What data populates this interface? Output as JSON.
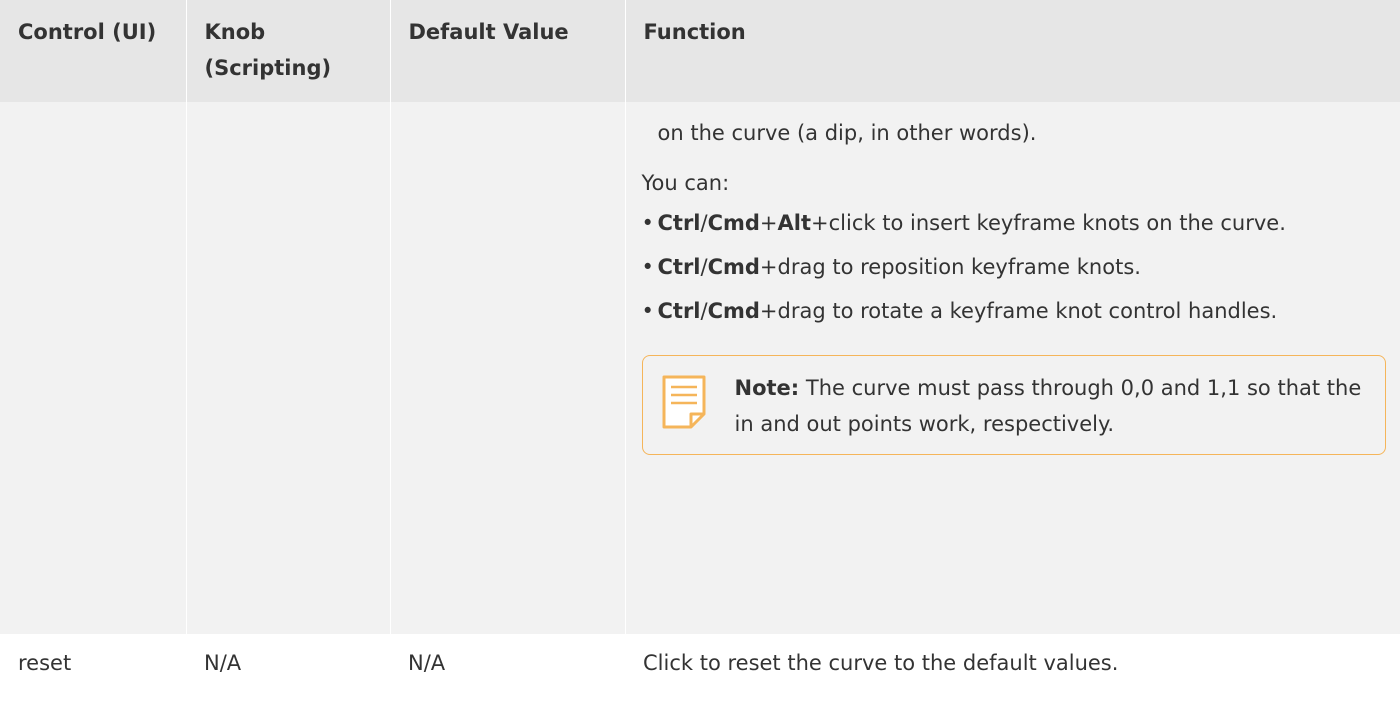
{
  "header": {
    "col1": "Control (UI)",
    "col2": "Knob (Scripting)",
    "col3": "Default Value",
    "col4": "Function"
  },
  "continued_row": {
    "function_continuation": "on the curve (a dip, in other words).",
    "you_can": "You can:",
    "items": [
      {
        "key1": "Ctrl",
        "sep1": "/",
        "key2": "Cmd",
        "plus1": "+",
        "key3": "Alt",
        "rest": "+click to insert keyframe knots on the curve."
      },
      {
        "key1": "Ctrl",
        "sep1": "/",
        "key2": "Cmd",
        "rest": "+drag to reposition keyframe knots."
      },
      {
        "key1": "Ctrl",
        "sep1": "/",
        "key2": "Cmd",
        "rest": "+drag to rotate a keyframe knot control handles."
      }
    ],
    "note": {
      "label": "Note:",
      "text": " The curve must pass through 0,0 and 1,1 so that the in and out points work, respectively.",
      "icon": "note-document-icon",
      "border_color": "#f5b55a"
    }
  },
  "reset_row": {
    "control": "reset",
    "knob": "N/A",
    "default": "N/A",
    "function": "Click to reset the curve to the default values."
  },
  "colors": {
    "header_bg": "#e6e6e6",
    "row_bg": "#f2f2f2",
    "text": "#333333"
  }
}
